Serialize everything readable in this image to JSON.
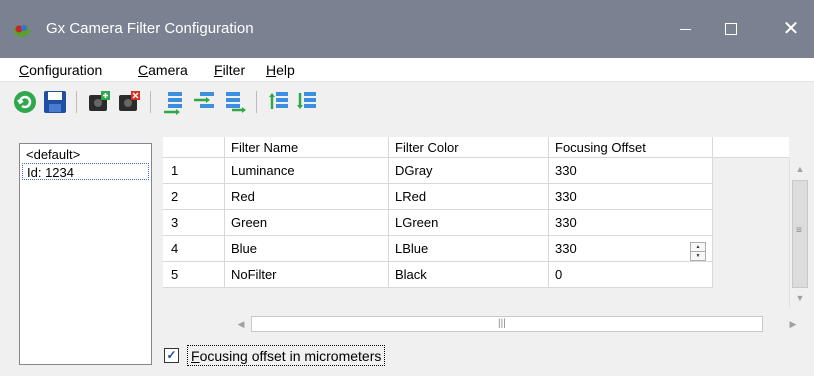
{
  "window": {
    "title": "Gx Camera Filter Configuration",
    "minimize_glyph": "",
    "maximize_glyph": "",
    "close_glyph": "✕"
  },
  "menu": [
    {
      "mnemonic": "C",
      "rest": "onfiguration"
    },
    {
      "mnemonic": "C",
      "rest": "amera"
    },
    {
      "mnemonic": "F",
      "rest": "ilter"
    },
    {
      "mnemonic": "H",
      "rest": "elp"
    }
  ],
  "toolbar": {
    "icons": [
      "refresh-icon",
      "save-icon",
      "add-camera-icon",
      "delete-camera-icon",
      "add-filter-icon",
      "insert-filter-icon",
      "append-filter-icon",
      "move-filter-up-icon",
      "move-filter-down-icon"
    ]
  },
  "cameras": [
    "<default>",
    "Id: 1234"
  ],
  "selected_camera_index": 1,
  "grid": {
    "columns": [
      "Filter Name",
      "Filter Color",
      "Focusing Offset"
    ],
    "rows": [
      {
        "num": "1",
        "name": "Luminance",
        "color": "DGray",
        "offset": "330"
      },
      {
        "num": "2",
        "name": "Red",
        "color": "LRed",
        "offset": "330"
      },
      {
        "num": "3",
        "name": "Green",
        "color": "LGreen",
        "offset": "330"
      },
      {
        "num": "4",
        "name": "Blue",
        "color": "LBlue",
        "offset": "330"
      },
      {
        "num": "5",
        "name": "NoFilter",
        "color": "Black",
        "offset": "0"
      }
    ],
    "editing_row": 4
  },
  "option": {
    "checked": true,
    "mnemonic": "F",
    "rest": "ocusing offset in micrometers"
  },
  "colors": {
    "titlebar": "#7a8291",
    "accent": "#1a4da8",
    "toolbar_green": "#2ea84a"
  }
}
